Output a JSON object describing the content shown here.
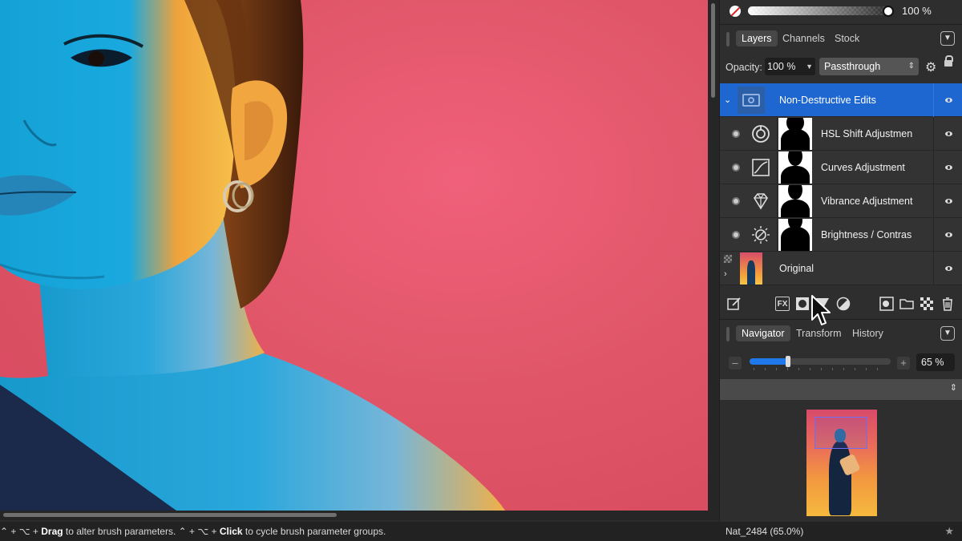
{
  "statusbar": {
    "prefix": "⌃ + ⌥ + ",
    "action1": "Drag",
    "text1": " to alter brush parameters. ",
    "prefix2": "⌃ + ⌥ + ",
    "action2": "Click",
    "text2": " to cycle brush parameter groups."
  },
  "document": {
    "title": "Nat_2484 (65.0%)",
    "star": "★"
  },
  "color_bar": {
    "opacity_label": "100 %",
    "opacity_fraction": 1.0
  },
  "layers_panel": {
    "tabs": [
      "Layers",
      "Channels",
      "Stock"
    ],
    "active_tab": "Layers",
    "opacity_label": "Opacity:",
    "opacity_value": "100 %",
    "blend_mode": "Passthrough",
    "layers": [
      {
        "name": "Non-Destructive Edits",
        "type": "group",
        "selected": true,
        "icon": "group-icon"
      },
      {
        "name": "HSL Shift Adjustmen",
        "type": "adjustment",
        "icon": "hsl-icon"
      },
      {
        "name": "Curves Adjustment",
        "type": "adjustment",
        "icon": "curves-icon"
      },
      {
        "name": "Vibrance Adjustment",
        "type": "adjustment",
        "icon": "vibrance-icon"
      },
      {
        "name": "Brightness / Contras",
        "type": "adjustment",
        "icon": "brightness-icon"
      },
      {
        "name": "Original",
        "type": "pixel",
        "icon": "image-thumbnail"
      }
    ]
  },
  "layer_toolbar": {
    "fx_label": "FX"
  },
  "navigator_panel": {
    "tabs": [
      "Navigator",
      "Transform",
      "History"
    ],
    "active_tab": "Navigator",
    "zoom_value": "65 %",
    "zoom_fraction": 0.27,
    "minus_label": "–",
    "plus_label": "+"
  },
  "colors": {
    "accent": "#1f67d0",
    "canvas_bg": "#e05668",
    "panel_bg": "#2e2e2e"
  }
}
